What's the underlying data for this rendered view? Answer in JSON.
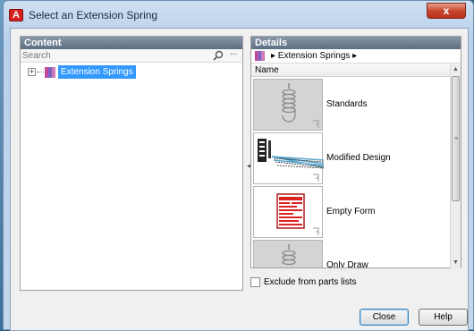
{
  "window": {
    "title": "Select an Extension Spring",
    "app_icon_letter": "A",
    "close_glyph": "x"
  },
  "content": {
    "header": "Content",
    "search_placeholder": "Search",
    "search_more": "...",
    "tree": {
      "expander": "+",
      "label": "Extension Springs"
    }
  },
  "details": {
    "header": "Details",
    "breadcrumb": "▸ Extension Springs ▸",
    "column_name": "Name",
    "items": [
      {
        "label": "Standards",
        "icon": "spring-icon"
      },
      {
        "label": "Modified Design",
        "icon": "spring-drawing-icon"
      },
      {
        "label": "Empty Form",
        "icon": "form-icon"
      },
      {
        "label": "Only Draw",
        "icon": "spring-icon"
      }
    ]
  },
  "exclude_label": "Exclude from parts lists",
  "buttons": {
    "close": "Close",
    "help": "Help"
  },
  "colors": {
    "selection": "#3399ff",
    "header_bg": "#6e7d90",
    "title_close": "#c8452d"
  }
}
